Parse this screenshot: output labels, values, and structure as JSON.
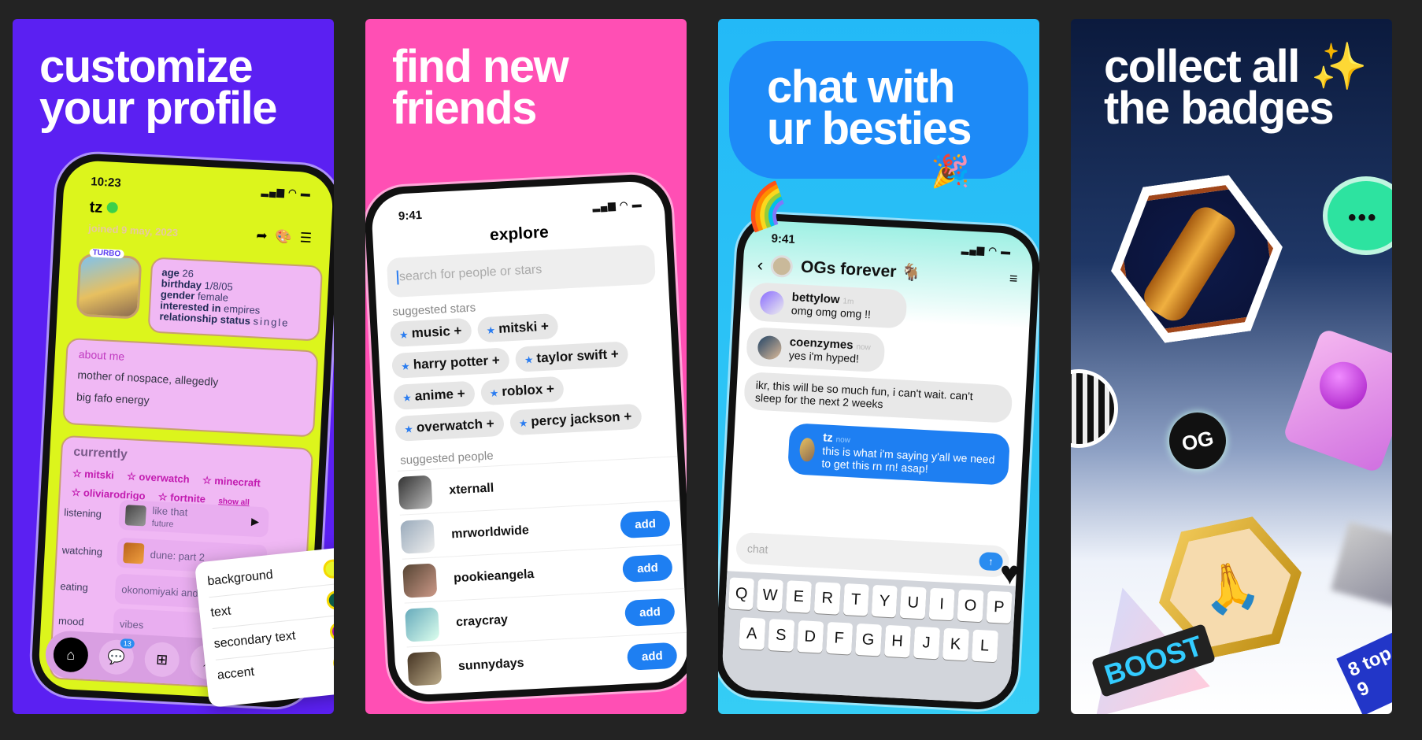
{
  "panels": [
    {
      "headline": "customize\nyour profile"
    },
    {
      "headline": "find new\nfriends"
    },
    {
      "headline": "chat with\nur besties"
    },
    {
      "headline": "collect all ✨\nthe badges"
    }
  ],
  "profile": {
    "time": "10:23",
    "username": "tz",
    "joined": "joined 9 may, 2023",
    "avatar_badge": "TURBO",
    "info": [
      {
        "label": "age",
        "value": "26"
      },
      {
        "label": "birthday",
        "value": "1/8/05"
      },
      {
        "label": "gender",
        "value": "female"
      },
      {
        "label": "interested in",
        "value": "empires"
      },
      {
        "label": "relationship status",
        "value": "single"
      }
    ],
    "about_title": "about me",
    "about_lines": [
      "mother of nospace, allegedly",
      "big fafo energy"
    ],
    "currently_title": "currently",
    "currently_stars": [
      "mitski",
      "overwatch",
      "minecraft",
      "oliviarodrigo",
      "fortnite"
    ],
    "show_all": "show all",
    "activities": [
      {
        "label": "listening",
        "title": "like that",
        "subtitle": "future"
      },
      {
        "label": "watching",
        "title": "dune: part 2"
      },
      {
        "label": "eating",
        "title": "okonomiyaki and s"
      },
      {
        "label": "mood",
        "title": "vibes"
      }
    ],
    "nav_badge": "13",
    "theme_options": [
      {
        "label": "background",
        "color": "#e8f52a"
      },
      {
        "label": "text",
        "color": "#0b5a4a"
      },
      {
        "label": "secondary text",
        "color": "#a010a8"
      },
      {
        "label": "accent",
        "color": "#e79ae8"
      }
    ]
  },
  "explore": {
    "time": "9:41",
    "title": "explore",
    "search_placeholder": "search for people or stars",
    "suggested_stars_title": "suggested stars",
    "stars": [
      "music",
      "mitski",
      "harry potter",
      "taylor swift",
      "anime",
      "roblox",
      "overwatch",
      "percy jackson"
    ],
    "suggested_people_title": "suggested people",
    "people": [
      {
        "name": "xternall",
        "button": ""
      },
      {
        "name": "mrworldwide",
        "button": "add"
      },
      {
        "name": "pookieangela",
        "button": "add"
      },
      {
        "name": "craycray",
        "button": "add"
      },
      {
        "name": "sunnydays",
        "button": "add"
      }
    ]
  },
  "chat": {
    "time": "9:41",
    "title": "OGs forever 🐐",
    "messages": [
      {
        "user": "bettylow",
        "time": "1m",
        "text": "omg omg omg !!"
      },
      {
        "user": "coenzymes",
        "time": "now",
        "text": "yes i'm hyped!"
      },
      {
        "user": "",
        "time": "",
        "text": "ikr, this will be so much fun, i can't wait. can't sleep for the next 2 weeks"
      },
      {
        "user": "tz",
        "time": "now",
        "text": "this is what i'm saying y'all we need to get this rn rn! asap!"
      }
    ],
    "input_placeholder": "chat",
    "send": "↑",
    "keyboard": [
      [
        "Q",
        "W",
        "E",
        "R",
        "T",
        "Y",
        "U",
        "I",
        "O",
        "P"
      ],
      [
        "A",
        "S",
        "D",
        "F",
        "G",
        "H",
        "J",
        "K",
        "L"
      ]
    ]
  },
  "badges": {
    "og": "OG",
    "boost": "BOOST",
    "top": "8 top 9"
  },
  "colors": {
    "purple": "#5b20f2",
    "pink": "#ff4fb4",
    "cyan": "#23b9f7",
    "lime": "#dcf51c",
    "blue": "#1e7ff2"
  }
}
